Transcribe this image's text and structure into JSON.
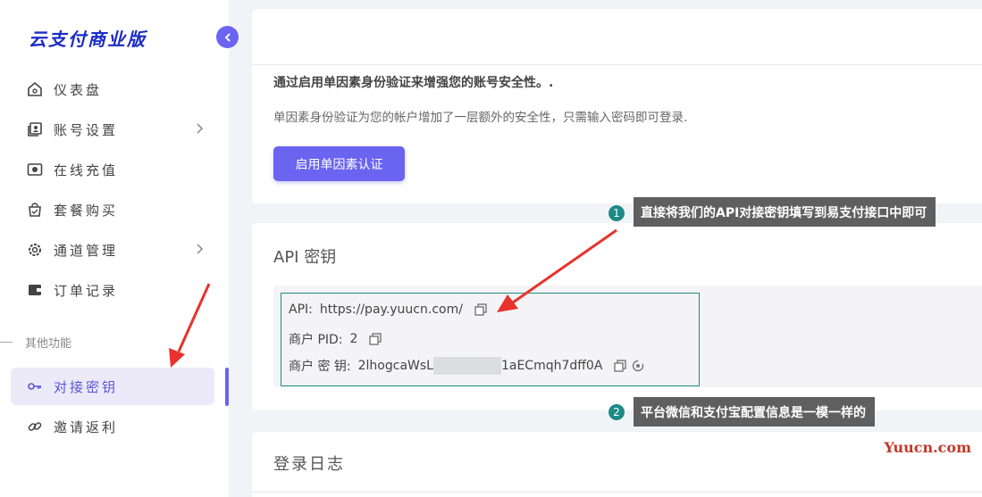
{
  "sidebar": {
    "logo": "云支付商业版",
    "items": [
      {
        "label": "仪表盘",
        "icon": "home-icon"
      },
      {
        "label": "账号设置",
        "icon": "account-icon"
      },
      {
        "label": "在线充值",
        "icon": "camera-icon"
      },
      {
        "label": "套餐购买",
        "icon": "bag-icon"
      },
      {
        "label": "通道管理",
        "icon": "gear-icon"
      },
      {
        "label": "订单记录",
        "icon": "wallet-icon"
      }
    ],
    "section_label": "其他功能",
    "extra_items": [
      {
        "label": "对接密钥",
        "icon": "key-icon",
        "active": true
      },
      {
        "label": "邀请返利",
        "icon": "link-icon"
      }
    ]
  },
  "security": {
    "title": "通过启用单因素身份验证来增强您的账号安全性。.",
    "description": "单因素身份验证为您的帐户增加了一层额外的安全性，只需输入密码即可登录.",
    "button": "启用单因素认证"
  },
  "api_keys": {
    "title": "API 密钥",
    "api_label": "API:",
    "api_value": "https://pay.yuucn.com/",
    "pid_label": "商户 PID:",
    "pid_value": "2",
    "key_label": "商户 密 钥:",
    "key_prefix": "2lhogcaWsL",
    "key_suffix": "1aECmqh7dff0A"
  },
  "login_log": {
    "title": "登录日志"
  },
  "annotations": {
    "tip1_num": "1",
    "tip1": "直接将我们的API对接密钥填写到易支付接口中即可",
    "tip2_num": "2",
    "tip2": "平台微信和支付宝配置信息是一模一样的"
  },
  "watermark": "Yuucn.com",
  "colors": {
    "accent": "#6a64f1",
    "teal": "#1e8a86",
    "arrow": "#e8322b"
  }
}
